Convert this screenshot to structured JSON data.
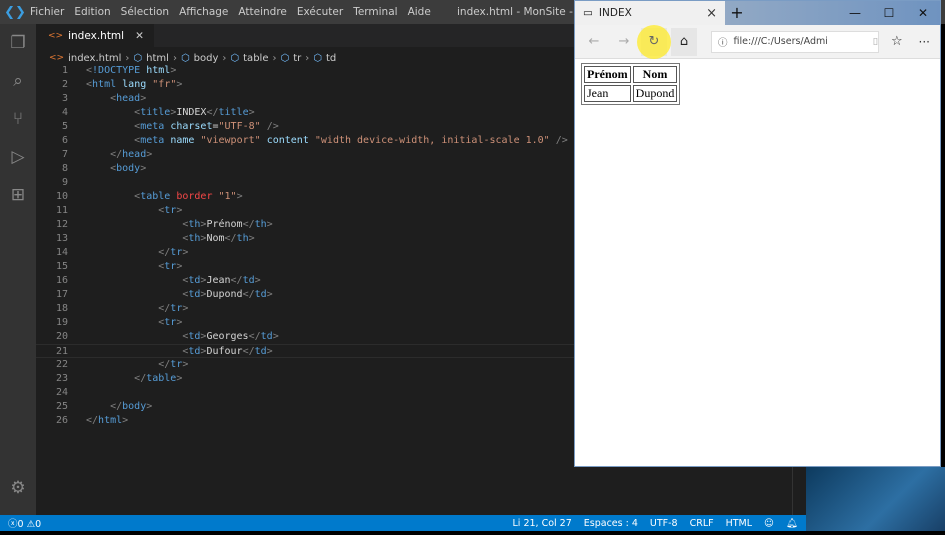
{
  "titlebar": {
    "menu": [
      "Fichier",
      "Edition",
      "Sélection",
      "Affichage",
      "Atteindre",
      "Exécuter",
      "Terminal",
      "Aide"
    ],
    "title": "index.html - MonSite - Visual"
  },
  "tab": {
    "label": "index.html"
  },
  "breadcrumb": [
    "index.html",
    "html",
    "body",
    "table",
    "tr",
    "td"
  ],
  "editor": {
    "lines": [
      {
        "n": "1",
        "tokens": [
          [
            "p",
            "<"
          ],
          [
            "t",
            "!DOCTYPE"
          ],
          [
            "x",
            " "
          ],
          [
            "a",
            "html"
          ],
          [
            "p",
            ">"
          ]
        ]
      },
      {
        "n": "2",
        "tokens": [
          [
            "p",
            "<"
          ],
          [
            "t",
            "html"
          ],
          [
            "x",
            " "
          ],
          [
            "a",
            "lang"
          ],
          [
            "x",
            " "
          ],
          [
            "s",
            "\"fr\""
          ],
          [
            "p",
            ">"
          ]
        ]
      },
      {
        "n": "3",
        "tokens": [
          [
            "x",
            "    "
          ],
          [
            "p",
            "<"
          ],
          [
            "t",
            "head"
          ],
          [
            "p",
            ">"
          ]
        ]
      },
      {
        "n": "4",
        "tokens": [
          [
            "x",
            "        "
          ],
          [
            "p",
            "<"
          ],
          [
            "t",
            "title"
          ],
          [
            "p",
            ">"
          ],
          [
            "x",
            "INDEX"
          ],
          [
            "p",
            "</"
          ],
          [
            "t",
            "title"
          ],
          [
            "p",
            ">"
          ]
        ]
      },
      {
        "n": "5",
        "tokens": [
          [
            "x",
            "        "
          ],
          [
            "p",
            "<"
          ],
          [
            "t",
            "meta"
          ],
          [
            "x",
            " "
          ],
          [
            "a",
            "charset"
          ],
          [
            "x",
            "="
          ],
          [
            "s",
            "\"UTF-8\""
          ],
          [
            "x",
            " "
          ],
          [
            "p",
            "/>"
          ]
        ]
      },
      {
        "n": "6",
        "tokens": [
          [
            "x",
            "        "
          ],
          [
            "p",
            "<"
          ],
          [
            "t",
            "meta"
          ],
          [
            "x",
            " "
          ],
          [
            "a",
            "name"
          ],
          [
            "x",
            " "
          ],
          [
            "s",
            "\"viewport\""
          ],
          [
            "x",
            " "
          ],
          [
            "a",
            "content"
          ],
          [
            "x",
            " "
          ],
          [
            "s",
            "\"width device-width, initial-scale 1.0\""
          ],
          [
            "x",
            " "
          ],
          [
            "p",
            "/>"
          ]
        ]
      },
      {
        "n": "7",
        "tokens": [
          [
            "x",
            "    "
          ],
          [
            "p",
            "</"
          ],
          [
            "t",
            "head"
          ],
          [
            "p",
            ">"
          ]
        ]
      },
      {
        "n": "8",
        "tokens": [
          [
            "x",
            "    "
          ],
          [
            "p",
            "<"
          ],
          [
            "t",
            "body"
          ],
          [
            "p",
            ">"
          ]
        ]
      },
      {
        "n": "9",
        "tokens": []
      },
      {
        "n": "10",
        "tokens": [
          [
            "x",
            "        "
          ],
          [
            "p",
            "<"
          ],
          [
            "t",
            "table"
          ],
          [
            "x",
            " "
          ],
          [
            "e",
            "border"
          ],
          [
            "x",
            " "
          ],
          [
            "s",
            "\"1\""
          ],
          [
            "p",
            ">"
          ]
        ]
      },
      {
        "n": "11",
        "tokens": [
          [
            "x",
            "            "
          ],
          [
            "p",
            "<"
          ],
          [
            "t",
            "tr"
          ],
          [
            "p",
            ">"
          ]
        ]
      },
      {
        "n": "12",
        "tokens": [
          [
            "x",
            "                "
          ],
          [
            "p",
            "<"
          ],
          [
            "t",
            "th"
          ],
          [
            "p",
            ">"
          ],
          [
            "x",
            "Prénom"
          ],
          [
            "p",
            "</"
          ],
          [
            "t",
            "th"
          ],
          [
            "p",
            ">"
          ]
        ]
      },
      {
        "n": "13",
        "tokens": [
          [
            "x",
            "                "
          ],
          [
            "p",
            "<"
          ],
          [
            "t",
            "th"
          ],
          [
            "p",
            ">"
          ],
          [
            "x",
            "Nom"
          ],
          [
            "p",
            "</"
          ],
          [
            "t",
            "th"
          ],
          [
            "p",
            ">"
          ]
        ]
      },
      {
        "n": "14",
        "tokens": [
          [
            "x",
            "            "
          ],
          [
            "p",
            "</"
          ],
          [
            "t",
            "tr"
          ],
          [
            "p",
            ">"
          ]
        ]
      },
      {
        "n": "15",
        "tokens": [
          [
            "x",
            "            "
          ],
          [
            "p",
            "<"
          ],
          [
            "t",
            "tr"
          ],
          [
            "p",
            ">"
          ]
        ]
      },
      {
        "n": "16",
        "tokens": [
          [
            "x",
            "                "
          ],
          [
            "p",
            "<"
          ],
          [
            "t",
            "td"
          ],
          [
            "p",
            ">"
          ],
          [
            "x",
            "Jean"
          ],
          [
            "p",
            "</"
          ],
          [
            "t",
            "td"
          ],
          [
            "p",
            ">"
          ]
        ]
      },
      {
        "n": "17",
        "tokens": [
          [
            "x",
            "                "
          ],
          [
            "p",
            "<"
          ],
          [
            "t",
            "td"
          ],
          [
            "p",
            ">"
          ],
          [
            "x",
            "Dupond"
          ],
          [
            "p",
            "</"
          ],
          [
            "t",
            "td"
          ],
          [
            "p",
            ">"
          ]
        ]
      },
      {
        "n": "18",
        "tokens": [
          [
            "x",
            "            "
          ],
          [
            "p",
            "</"
          ],
          [
            "t",
            "tr"
          ],
          [
            "p",
            ">"
          ]
        ]
      },
      {
        "n": "19",
        "tokens": [
          [
            "x",
            "            "
          ],
          [
            "p",
            "<"
          ],
          [
            "t",
            "tr"
          ],
          [
            "p",
            ">"
          ]
        ]
      },
      {
        "n": "20",
        "tokens": [
          [
            "x",
            "                "
          ],
          [
            "p",
            "<"
          ],
          [
            "t",
            "td"
          ],
          [
            "p",
            ">"
          ],
          [
            "x",
            "Georges"
          ],
          [
            "p",
            "</"
          ],
          [
            "t",
            "td"
          ],
          [
            "p",
            ">"
          ]
        ]
      },
      {
        "n": "21",
        "current": true,
        "tokens": [
          [
            "x",
            "                "
          ],
          [
            "p",
            "<"
          ],
          [
            "t",
            "td"
          ],
          [
            "p",
            ">"
          ],
          [
            "x",
            "Dufour"
          ],
          [
            "p",
            "</"
          ],
          [
            "t",
            "td"
          ],
          [
            "p",
            ">"
          ]
        ]
      },
      {
        "n": "22",
        "tokens": [
          [
            "x",
            "            "
          ],
          [
            "p",
            "</"
          ],
          [
            "t",
            "tr"
          ],
          [
            "p",
            ">"
          ]
        ]
      },
      {
        "n": "23",
        "tokens": [
          [
            "x",
            "        "
          ],
          [
            "p",
            "</"
          ],
          [
            "t",
            "table"
          ],
          [
            "p",
            ">"
          ]
        ]
      },
      {
        "n": "24",
        "tokens": []
      },
      {
        "n": "25",
        "tokens": [
          [
            "x",
            "    "
          ],
          [
            "p",
            "</"
          ],
          [
            "t",
            "body"
          ],
          [
            "p",
            ">"
          ]
        ]
      },
      {
        "n": "26",
        "tokens": [
          [
            "p",
            "</"
          ],
          [
            "t",
            "html"
          ],
          [
            "p",
            ">"
          ]
        ]
      }
    ]
  },
  "status": {
    "errors": "0",
    "warnings": "0",
    "position": "Li 21, Col 27",
    "spaces": "Espaces : 4",
    "encoding": "UTF-8",
    "eol": "CRLF",
    "language": "HTML"
  },
  "browser": {
    "tab_title": "INDEX",
    "address": "file:///C:/Users/Admi",
    "table": {
      "headers": [
        "Prénom",
        "Nom"
      ],
      "rows": [
        [
          "Jean",
          "Dupond"
        ]
      ]
    }
  },
  "colors": {
    "accent": "#007acc",
    "tag": "#569cd6",
    "attr": "#9cdcfe",
    "string": "#ce9178",
    "error": "#f44747"
  }
}
